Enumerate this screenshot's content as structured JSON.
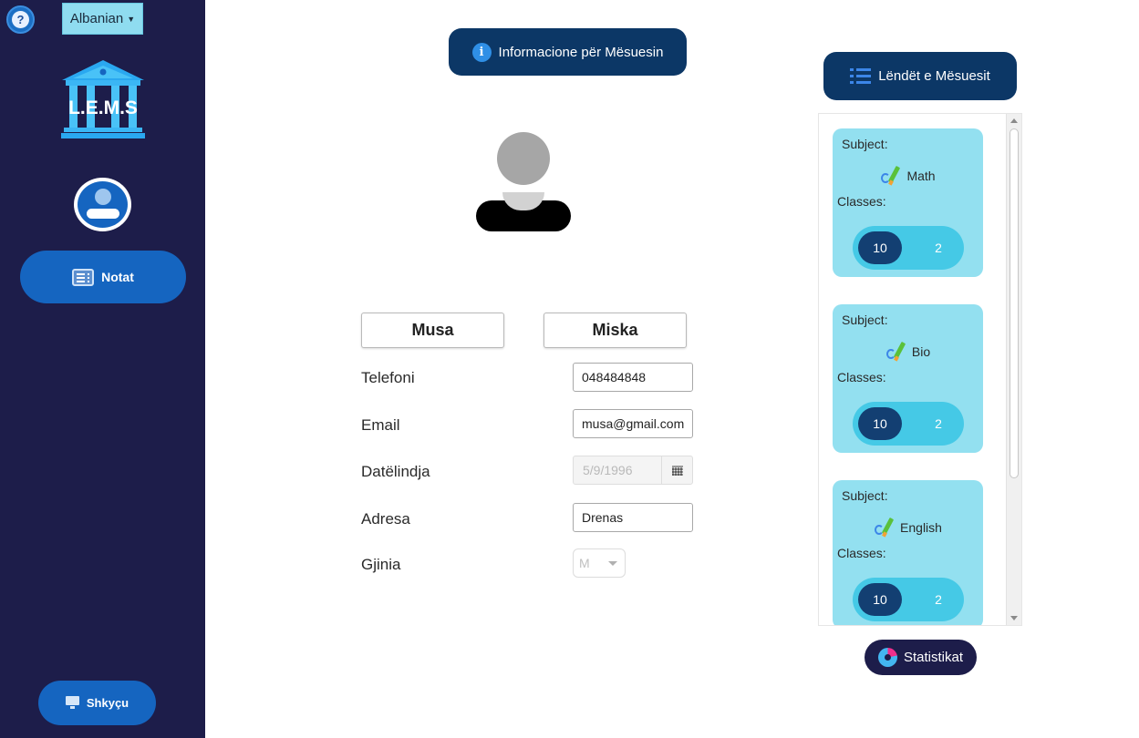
{
  "sidebar": {
    "help_icon": "question-mark-icon",
    "help_glyph": "?",
    "language": "Albanian",
    "logo_text": "L.E.M.S",
    "nav_items": [
      {
        "label": "Notat",
        "icon": "list-icon"
      }
    ],
    "logout_label": "Shkyçu"
  },
  "header": {
    "title": "Informacione për Mësuesin",
    "icon_glyph": "i"
  },
  "profile": {
    "first_name": "Musa",
    "last_name": "Miska",
    "fields": {
      "phone_label": "Telefoni",
      "phone_value": "048484848",
      "email_label": "Email",
      "email_value": "musa@gmail.com",
      "birthdate_label": "Datëlindja",
      "birthdate_value": "5/9/1996",
      "address_label": "Adresa",
      "address_value": "Drenas",
      "gender_label": "Gjinia",
      "gender_value": "M"
    }
  },
  "subjects": {
    "title": "Lëndët e Mësuesit",
    "subject_label": "Subject:",
    "classes_label": "Classes:",
    "items": [
      {
        "name": "Math",
        "classes": [
          "10",
          "2"
        ]
      },
      {
        "name": "Bio",
        "classes": [
          "10",
          "2"
        ]
      },
      {
        "name": "English",
        "classes": [
          "10",
          "2"
        ]
      }
    ]
  },
  "stats_label": "Statistikat",
  "colors": {
    "sidebar_bg": "#1d1d4a",
    "primary_blue": "#1565c0",
    "header_navy": "#0c3766",
    "card_cyan": "#93e0f0",
    "pill_cyan": "#45c9e6"
  }
}
